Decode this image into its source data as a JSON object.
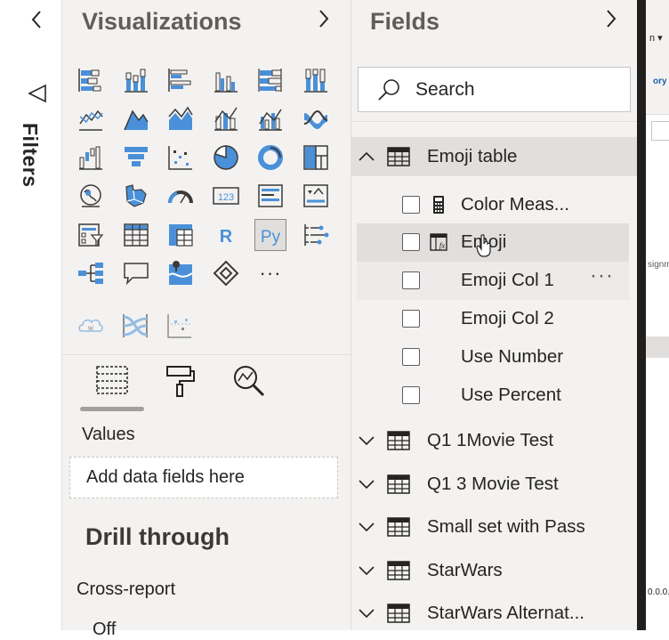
{
  "filters": {
    "label": "Filters"
  },
  "visualizations": {
    "title": "Visualizations",
    "icons": [
      "stacked-bar-chart-icon",
      "stacked-column-chart-icon",
      "clustered-bar-chart-icon",
      "clustered-column-chart-icon",
      "100-stacked-bar-chart-icon",
      "100-stacked-column-chart-icon",
      "line-chart-icon",
      "area-chart-icon",
      "stacked-area-chart-icon",
      "line-and-stacked-column-chart-icon",
      "line-and-clustered-column-chart-icon",
      "ribbon-chart-icon",
      "waterfall-chart-icon",
      "funnel-chart-icon",
      "scatter-chart-icon",
      "pie-chart-icon",
      "donut-chart-icon",
      "treemap-icon",
      "map-icon",
      "filled-map-icon",
      "gauge-icon",
      "card-icon",
      "multi-row-card-icon",
      "kpi-icon",
      "slicer-icon",
      "table-icon",
      "matrix-icon",
      "r-visual-icon",
      "python-visual-icon",
      "key-influencers-icon",
      "decomposition-tree-icon",
      "qa-icon",
      "arcgis-map-icon",
      "power-apps-icon",
      "more-visuals-icon"
    ],
    "card_text": "123",
    "r_text": "R",
    "python_text": "Py",
    "more_text": "···",
    "custom_icons": [
      "word-cloud-icon",
      "sankey-icon",
      "scatter-custom-icon"
    ],
    "word_cloud_text": "w",
    "tabs": [
      "fields-tab-icon",
      "format-tab-icon",
      "analytics-tab-icon"
    ],
    "values_label": "Values",
    "drop_placeholder": "Add data fields here",
    "drill_through": "Drill through",
    "cross_report": "Cross-report",
    "toggle_text": "Off"
  },
  "fields": {
    "title": "Fields",
    "search_placeholder": "Search",
    "tables": [
      {
        "name": "Emoji table",
        "expanded": true
      },
      {
        "name": "Q1 1Movie Test"
      },
      {
        "name": "Q1 3 Movie Test"
      },
      {
        "name": "Small set with Pass"
      },
      {
        "name": "StarWars"
      },
      {
        "name": "StarWars Alternat..."
      }
    ],
    "emoji_fields": [
      {
        "name": "Color Meas...",
        "icon": "calculator-icon"
      },
      {
        "name": "Emoji",
        "icon": "calculated-column-icon"
      },
      {
        "name": "Emoji Col 1"
      },
      {
        "name": "Emoji Col 2"
      },
      {
        "name": "Use Number"
      },
      {
        "name": "Use Percent"
      }
    ],
    "more_options": "···"
  },
  "peek": {
    "t1": "n ▾",
    "t2": "ory",
    "t3": "signm",
    "t4": "0.0.0."
  },
  "colors": {
    "accent": "#118dff",
    "icon_blue": "#4a90d9",
    "icon_dark": "#3b3a39",
    "pane": "#f3f2f1"
  }
}
